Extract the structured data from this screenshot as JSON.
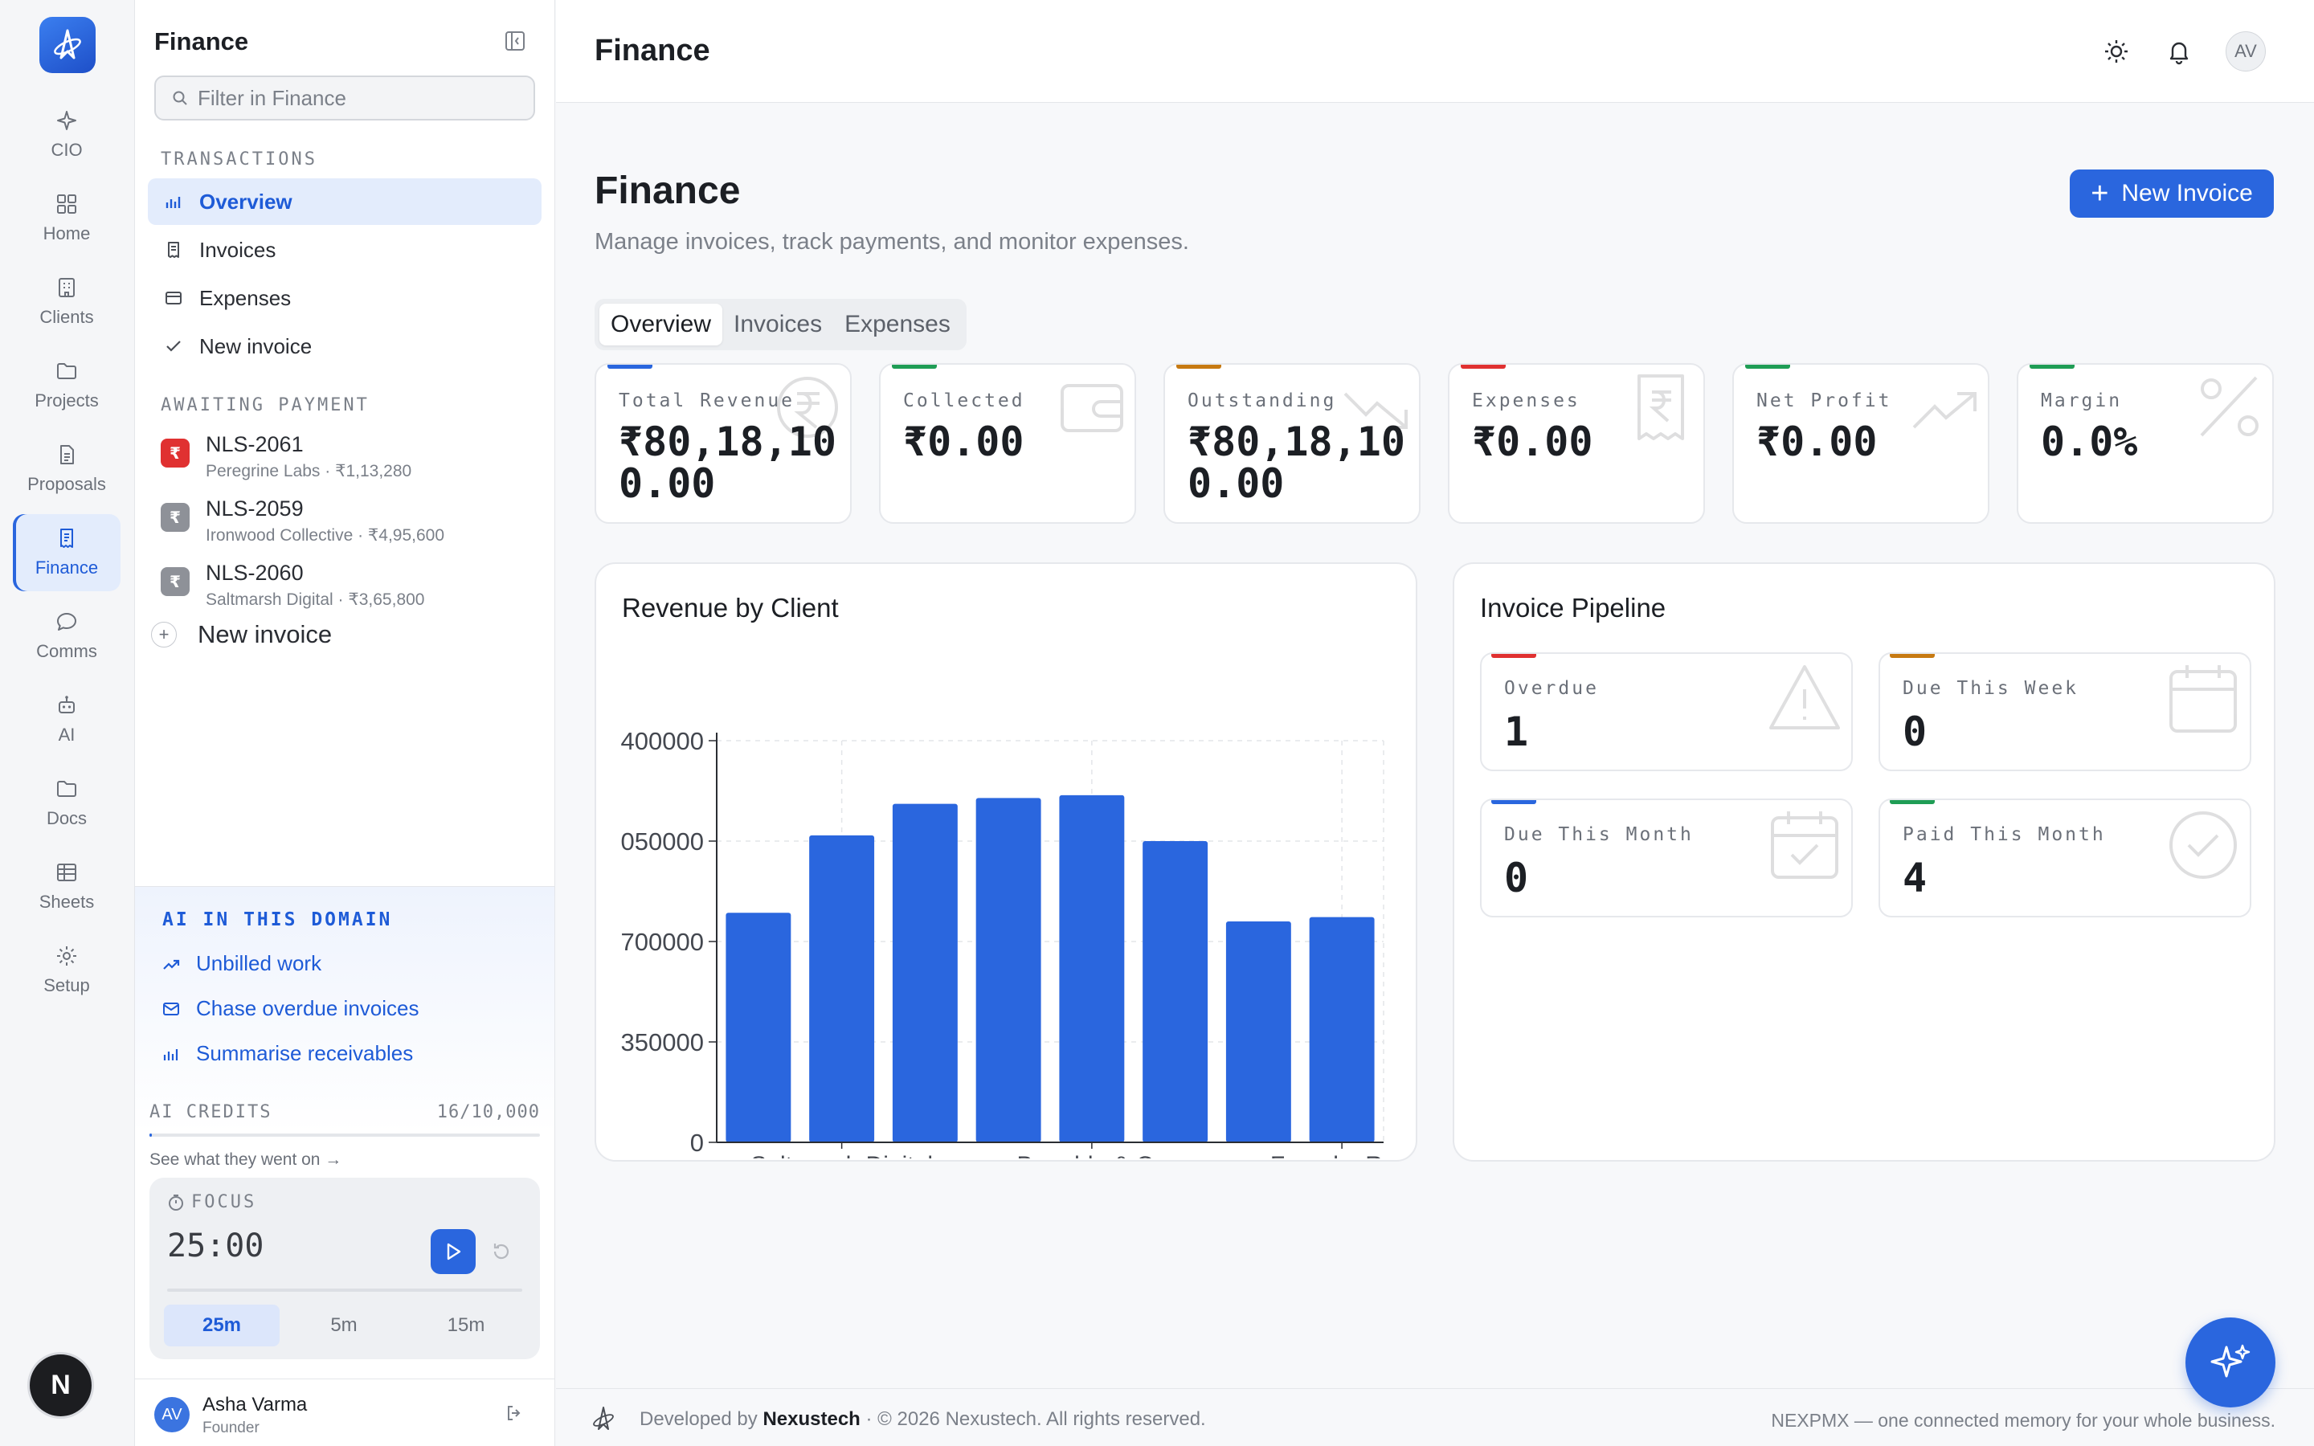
{
  "rail": {
    "items": [
      {
        "label": "CIO",
        "icon": "sparkle-icon"
      },
      {
        "label": "Home",
        "icon": "grid-icon"
      },
      {
        "label": "Clients",
        "icon": "building-icon"
      },
      {
        "label": "Projects",
        "icon": "folder-icon"
      },
      {
        "label": "Proposals",
        "icon": "document-icon"
      },
      {
        "label": "Finance",
        "icon": "receipt-icon"
      },
      {
        "label": "Comms",
        "icon": "chat-icon"
      },
      {
        "label": "AI",
        "icon": "robot-icon"
      },
      {
        "label": "Docs",
        "icon": "folder-icon"
      },
      {
        "label": "Sheets",
        "icon": "table-icon"
      },
      {
        "label": "Setup",
        "icon": "gear-icon"
      }
    ],
    "active": "Finance",
    "bottom_badge": "N"
  },
  "sidebar": {
    "title": "Finance",
    "search_placeholder": "Filter in Finance",
    "transactions_label": "TRANSACTIONS",
    "nav": [
      {
        "label": "Overview",
        "icon": "bar-chart-icon"
      },
      {
        "label": "Invoices",
        "icon": "receipt-icon"
      },
      {
        "label": "Expenses",
        "icon": "wallet-icon"
      },
      {
        "label": "New invoice",
        "icon": "check-icon"
      }
    ],
    "awaiting_label": "AWAITING PAYMENT",
    "awaiting": [
      {
        "id": "NLS-2061",
        "sub": "Peregrine Labs · ₹1,13,280",
        "color": "#e03131"
      },
      {
        "id": "NLS-2059",
        "sub": "Ironwood Collective · ₹4,95,600",
        "color": "#8e9198"
      },
      {
        "id": "NLS-2060",
        "sub": "Saltmarsh Digital · ₹3,65,800",
        "color": "#8e9198"
      }
    ],
    "badge_symbol": "₹",
    "new_invoice": "New invoice",
    "ai": {
      "title": "AI IN THIS DOMAIN",
      "links": [
        "Unbilled work",
        "Chase overdue invoices",
        "Summarise receivables"
      ]
    },
    "credits": {
      "label": "AI CREDITS",
      "value": "16/10,000",
      "fraction": 0.0016,
      "link": "See what they went on →"
    },
    "focus": {
      "label": "FOCUS",
      "time": "25:00",
      "presets": [
        "25m",
        "5m",
        "15m"
      ],
      "active_preset": "25m"
    },
    "user": {
      "initials": "AV",
      "name": "Asha Varma",
      "role": "Founder"
    }
  },
  "topbar": {
    "title": "Finance",
    "avatar": "AV"
  },
  "page": {
    "title": "Finance",
    "subtitle": "Manage invoices, track payments, and monitor expenses.",
    "new_button": "New Invoice",
    "tabs": [
      "Overview",
      "Invoices",
      "Expenses"
    ],
    "active_tab": "Overview"
  },
  "kpis": [
    {
      "label": "Total Revenue",
      "value": "₹80,18,100.00",
      "accent": "#2a66de",
      "icon": "rupee-icon"
    },
    {
      "label": "Collected",
      "value": "₹0.00",
      "accent": "#1f9d55",
      "icon": "wallet-icon"
    },
    {
      "label": "Outstanding",
      "value": "₹80,18,100.00",
      "accent": "#c77a12",
      "icon": "trend-down-icon"
    },
    {
      "label": "Expenses",
      "value": "₹0.00",
      "accent": "#e03131",
      "icon": "receipt-rupee-icon"
    },
    {
      "label": "Net Profit",
      "value": "₹0.00",
      "accent": "#1f9d55",
      "icon": "trend-up-icon"
    },
    {
      "label": "Margin",
      "value": "0.0%",
      "accent": "#1f9d55",
      "icon": "percent-icon"
    }
  ],
  "revenue_panel": {
    "title": "Revenue by Client"
  },
  "chart_data": {
    "type": "bar",
    "title": "Revenue by Client",
    "categories": [
      "",
      "Saltmarsh Digital",
      "",
      "",
      "Bramble & Co",
      "",
      "",
      "Foundry Row"
    ],
    "values": [
      800000,
      1070000,
      1180000,
      1200000,
      1210000,
      1050000,
      770000,
      785000
    ],
    "ylim": [
      0,
      1400000
    ],
    "yticks": [
      0,
      350000,
      700000,
      1050000,
      1400000
    ],
    "ytick_labels": [
      "0",
      "350000",
      "700000",
      "050000",
      "400000"
    ],
    "xtick_labels": [
      "Saltmarsh Digital",
      "Bramble & Co",
      "Foundry Row"
    ],
    "color": "#2a66de",
    "grid": true
  },
  "pipeline": {
    "title": "Invoice Pipeline",
    "cards": [
      {
        "label": "Overdue",
        "value": "1",
        "accent": "#e03131",
        "icon": "warning-icon"
      },
      {
        "label": "Due This Week",
        "value": "0",
        "accent": "#c77a12",
        "icon": "calendar-icon"
      },
      {
        "label": "Due This Month",
        "value": "0",
        "accent": "#2a66de",
        "icon": "calendar-check-icon"
      },
      {
        "label": "Paid This Month",
        "value": "4",
        "accent": "#1f9d55",
        "icon": "check-circle-icon"
      }
    ]
  },
  "footer": {
    "developed_by": "Developed by",
    "company": "Nexustech",
    "rights": "· © 2026 Nexustech. All rights reserved.",
    "tagline": "NEXPMX — one connected memory for your whole business."
  }
}
